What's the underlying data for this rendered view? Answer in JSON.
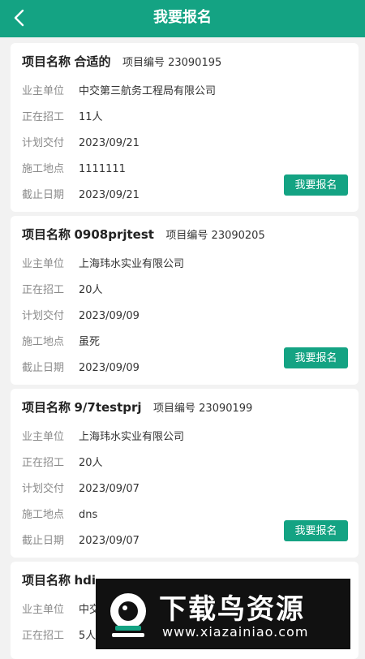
{
  "header": {
    "title": "我要报名"
  },
  "labels": {
    "name": "项目名称",
    "code": "项目编号",
    "owner": "业主单位",
    "hiring": "正在招工",
    "delivery": "计划交付",
    "site": "施工地点",
    "deadline": "截止日期",
    "signup": "我要报名"
  },
  "cards": [
    {
      "name": "合适的",
      "code": "23090195",
      "owner": "中交第三航务工程局有限公司",
      "hiring": "11人",
      "delivery": "2023/09/21",
      "site": "1111111",
      "deadline": "2023/09/21"
    },
    {
      "name": "0908prjtest",
      "code": "23090205",
      "owner": "上海玮水实业有限公司",
      "hiring": "20人",
      "delivery": "2023/09/09",
      "site": "虽死",
      "deadline": "2023/09/09"
    },
    {
      "name": "9/7testprj",
      "code": "23090199",
      "owner": "上海玮水实业有限公司",
      "hiring": "20人",
      "delivery": "2023/09/07",
      "site": "dns",
      "deadline": "2023/09/07"
    },
    {
      "name": "hdi",
      "code": "",
      "owner": "中交",
      "hiring": "5人",
      "delivery": "",
      "site": "",
      "deadline": ""
    }
  ],
  "watermark": {
    "title": "下载鸟资源",
    "url": "www.xiazainiao.com"
  },
  "colors": {
    "accent": "#14a383",
    "background": "#f2f2f2"
  },
  "icons": {
    "back": "chevron-left-icon"
  }
}
